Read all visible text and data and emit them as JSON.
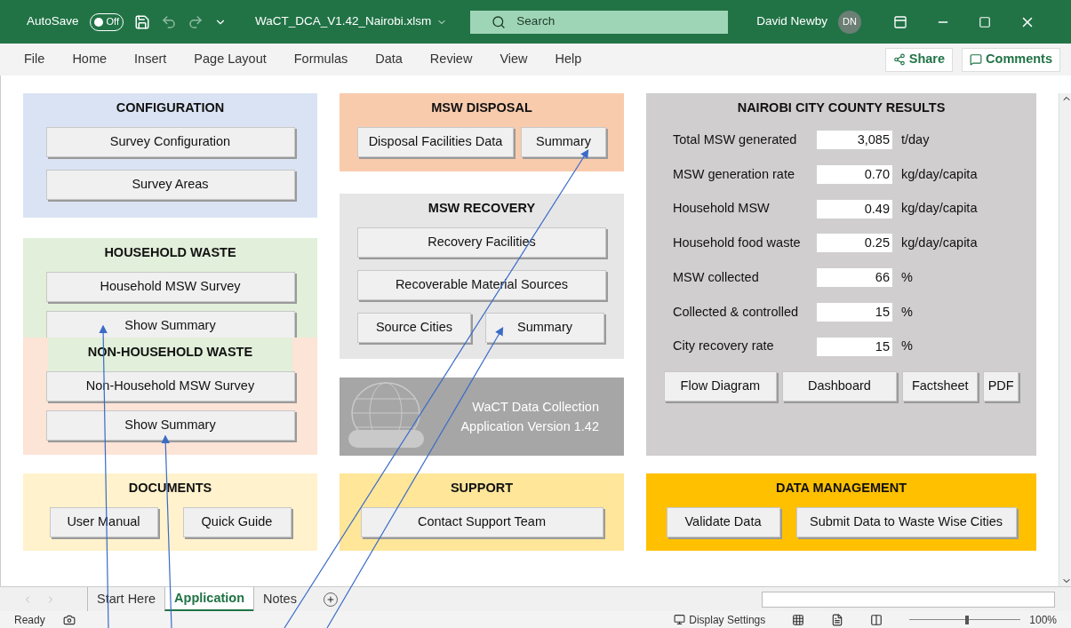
{
  "title_bar": {
    "autosave_label": "AutoSave",
    "autosave_toggle": {
      "label": "Off",
      "on": false
    },
    "file_name": "WaCT_DCA_V1.42_Nairobi.xlsm",
    "search": {
      "placeholder": "Search"
    },
    "user_name": "David Newby",
    "user_initials": "DN"
  },
  "ribbon": {
    "tabs": [
      {
        "label": "File",
        "selected": false
      },
      {
        "label": "Home",
        "selected": false
      },
      {
        "label": "Insert",
        "selected": false
      },
      {
        "label": "Page Layout",
        "selected": false
      },
      {
        "label": "Formulas",
        "selected": false
      },
      {
        "label": "Data",
        "selected": false
      },
      {
        "label": "Review",
        "selected": false
      },
      {
        "label": "View",
        "selected": false
      },
      {
        "label": "Help",
        "selected": false
      }
    ],
    "share": "Share",
    "comments": "Comments"
  },
  "configuration": {
    "title": "CONFIGURATION",
    "buttons": [
      "Survey Configuration",
      "Survey Areas"
    ]
  },
  "household_waste": {
    "title": "HOUSEHOLD WASTE",
    "buttons": [
      "Household MSW Survey",
      "Show Summary"
    ]
  },
  "non_household_waste": {
    "title": "NON-HOUSEHOLD WASTE",
    "buttons": [
      "Non-Household MSW Survey",
      "Show Summary"
    ]
  },
  "documents": {
    "title": "DOCUMENTS",
    "buttons": [
      "User Manual",
      "Quick Guide"
    ]
  },
  "msw_disposal": {
    "title": "MSW DISPOSAL",
    "buttons": [
      "Disposal Facilities Data",
      "Summary"
    ]
  },
  "msw_recovery": {
    "title": "MSW RECOVERY",
    "buttons": [
      "Recovery Facilities",
      "Recoverable Material Sources",
      "Source Cities",
      "Summary"
    ]
  },
  "app_banner": {
    "lines": [
      "WaCT Data Collection",
      "Application Version 1.42"
    ]
  },
  "support": {
    "title": "SUPPORT",
    "buttons": [
      "Contact Support Team"
    ]
  },
  "results": {
    "title": "NAIROBI CITY COUNTY RESULTS",
    "rows": [
      {
        "label": "Total MSW generated",
        "value": "3,085",
        "unit": "t/day"
      },
      {
        "label": "MSW generation rate",
        "value": "0.70",
        "unit": "kg/day/capita"
      },
      {
        "label": "Household MSW",
        "value": "0.49",
        "unit": "kg/day/capita"
      },
      {
        "label": "Household food waste",
        "value": "0.25",
        "unit": "kg/day/capita"
      },
      {
        "label": "MSW collected",
        "value": "66",
        "unit": "%"
      },
      {
        "label": "Collected & controlled",
        "value": "15",
        "unit": "%"
      },
      {
        "label": "City recovery rate",
        "value": "15",
        "unit": "%"
      }
    ],
    "buttons": [
      "Flow Diagram",
      "Dashboard",
      "Factsheet",
      "PDF"
    ]
  },
  "data_management": {
    "title": "DATA MANAGEMENT",
    "buttons": [
      "Validate Data",
      "Submit Data to Waste Wise Cities"
    ]
  },
  "sheet_tabs": [
    {
      "label": "Start Here",
      "selected": false
    },
    {
      "label": "Application",
      "selected": true
    },
    {
      "label": "Notes",
      "selected": false
    }
  ],
  "status_bar": {
    "status": "Ready",
    "display_settings": "Display Settings",
    "zoom": "100%",
    "zoom_slider": {
      "level": 0.5
    }
  }
}
